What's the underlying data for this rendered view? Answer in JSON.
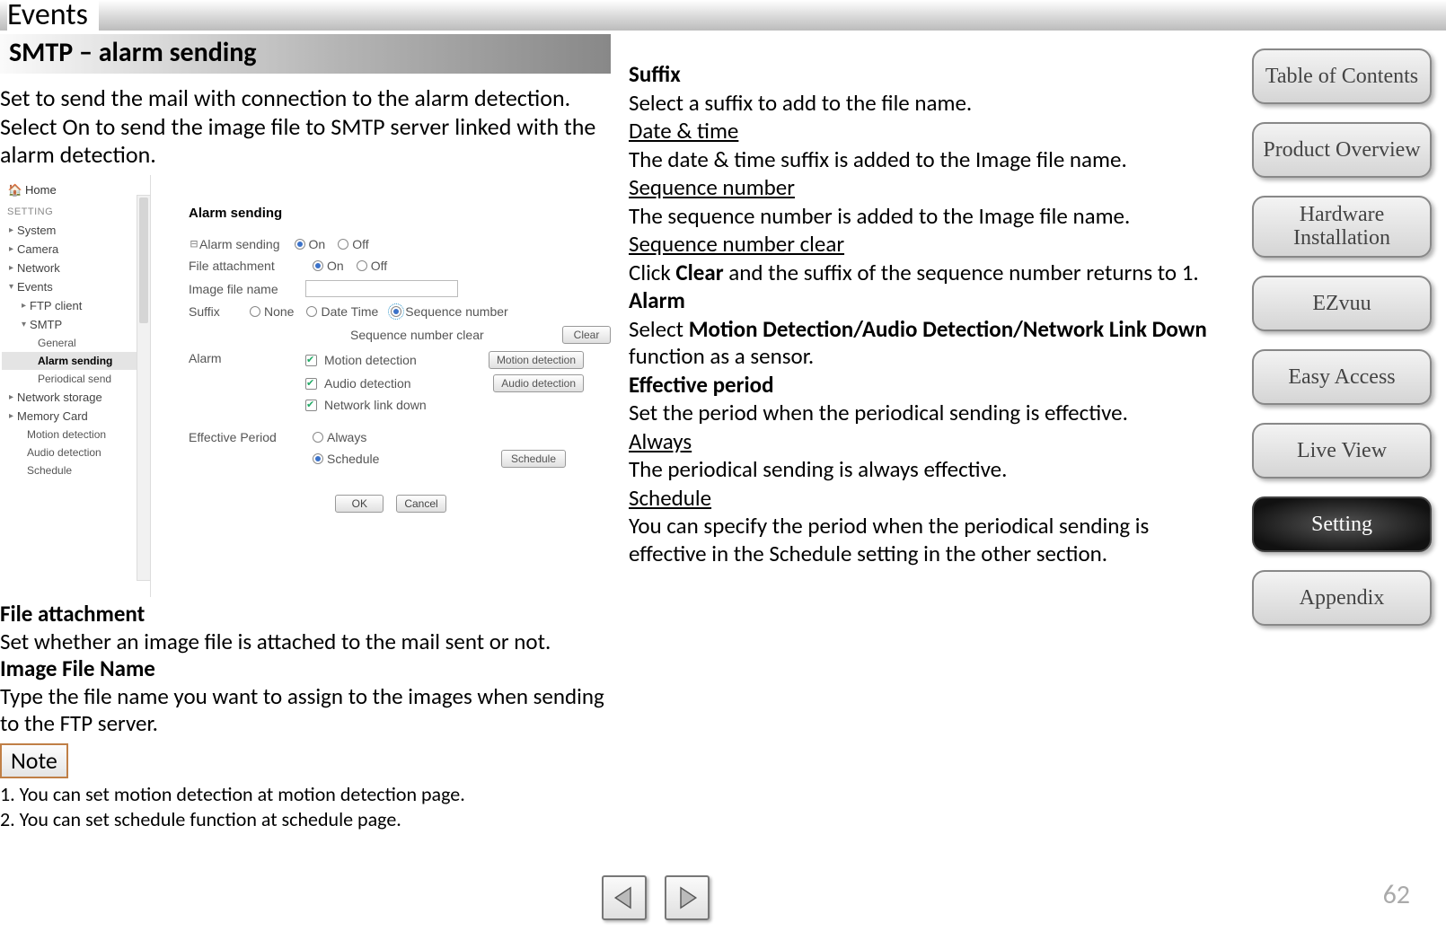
{
  "page_title": "Events",
  "page_number": "62",
  "section": {
    "title": "SMTP – alarm sending",
    "intro": "Set to send the mail with connection to the alarm detection. Select On to send the image file to SMTP server linked with the alarm detection."
  },
  "shot": {
    "tree": {
      "home": "Home",
      "setting": "SETTING",
      "system": "System",
      "camera": "Camera",
      "network": "Network",
      "events": "Events",
      "ftp": "FTP client",
      "smtp": "SMTP",
      "general": "General",
      "alarm_sending": "Alarm sending",
      "periodical": "Periodical send",
      "net_storage": "Network storage",
      "mem_card": "Memory Card",
      "motion_det": "Motion detection",
      "audio_det": "Audio detection",
      "schedule": "Schedule"
    },
    "pane": {
      "title": "Alarm sending",
      "alarm_sending_lbl": "Alarm sending",
      "on": "On",
      "off": "Off",
      "file_attach_lbl": "File attachment",
      "img_file_lbl": "Image file name",
      "suffix_lbl": "Suffix",
      "suffix_none": "None",
      "suffix_datetime": "Date Time",
      "suffix_seq": "Sequence number",
      "seq_clear_lbl": "Sequence number clear",
      "clear_btn": "Clear",
      "alarm_lbl": "Alarm",
      "alarm_motion": "Motion detection",
      "alarm_audio": "Audio detection",
      "alarm_netlink": "Network link down",
      "btn_motion": "Motion detection",
      "btn_audio": "Audio detection",
      "eff_period_lbl": "Effective Period",
      "always": "Always",
      "schedule": "Schedule",
      "schedule_btn": "Schedule",
      "ok": "OK",
      "cancel": "Cancel"
    }
  },
  "left_text": {
    "file_attach_h": "File attachment",
    "file_attach_p": "Set whether an image file is attached to the mail sent or not.",
    "img_name_h": "Image File Name",
    "img_name_p": "Type the file name you want to assign to the images when sending to the FTP server.",
    "note_btn": "Note",
    "note1": "1. You can set motion detection at motion detection page.",
    "note2": "2. You can set schedule function at schedule page."
  },
  "mid": {
    "suffix_h": "Suffix",
    "suffix_p": "Select a suffix to add to the file name.",
    "dt_u": "Date & time",
    "dt_p": "The date & time suffix is added to the Image file name.",
    "seq_u": "Sequence number",
    "seq_p": "The sequence number is added to the Image file name.",
    "seqc_u": "Sequence number clear",
    "seqc_p1": "Click ",
    "seqc_b": "Clear",
    "seqc_p2": " and the suffix of the sequence number returns to 1.",
    "alarm_h": "Alarm",
    "alarm_p1": "Select ",
    "alarm_b": "Motion Detection/Audio Detection/Network Link Down",
    "alarm_p2": "  function as a sensor.",
    "eff_h": "Effective period",
    "eff_p": "Set the period when the periodical sending is effective.",
    "always_u": "Always",
    "always_p": "The periodical sending is always effective.",
    "sched_u": "Schedule",
    "sched_p": "You can specify the period when the periodical sending is effective in the Schedule setting in the other section."
  },
  "nav": {
    "toc": "Table of Contents",
    "overview": "Product Overview",
    "hardware": "Hardware Installation",
    "ezvuu": "EZvuu",
    "easy": "Easy Access",
    "liveview": "Live View",
    "setting": "Setting",
    "appendix": "Appendix"
  }
}
